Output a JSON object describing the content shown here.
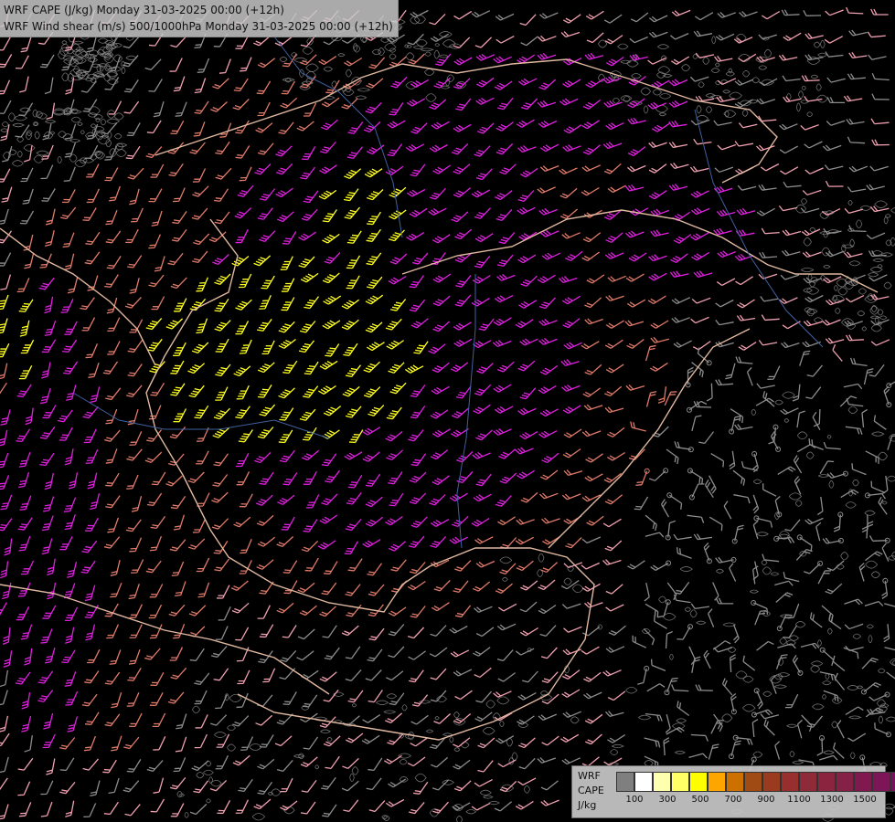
{
  "titles": {
    "line1": "WRF CAPE (J/kg) Monday 31-03-2025 00:00 (+12h)",
    "line2": "WRF Wind shear (m/s) 500/1000hPa Monday 31-03-2025 00:00 (+12h)"
  },
  "legend": {
    "label_model": "WRF",
    "label_field": "CAPE",
    "label_unit": "J/kg",
    "colors": [
      "#7f7f7f",
      "#ffffff",
      "#ffffb0",
      "#ffff66",
      "#ffff00",
      "#ffa500",
      "#cc7000",
      "#a04a14",
      "#9a3a1e",
      "#982f2f",
      "#8f2a38",
      "#8a243f",
      "#852046",
      "#801a4e",
      "#7c1656",
      "#78105e",
      "#740b68",
      "#700470"
    ],
    "tick_labels": [
      "100",
      "300",
      "500",
      "700",
      "900",
      "1100",
      "1300",
      "1500"
    ]
  },
  "map_colors": {
    "background": "#000000",
    "border": "#e0b8a0",
    "river": "#4060a0",
    "terrain": "#9a9a9a",
    "barb_grey": "#8c8c8c",
    "barb_salmon": "#e07a6a",
    "barb_magenta": "#e020e0",
    "barb_yellow": "#ffff20",
    "barb_pink": "#f0a0b0"
  }
}
